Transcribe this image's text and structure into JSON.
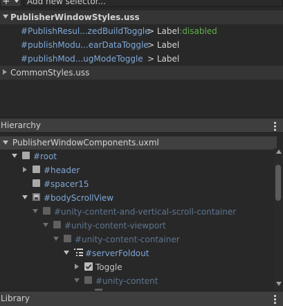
{
  "toolbar": {
    "add_icon": "plus-icon",
    "selector_placeholder": "Add new selector..."
  },
  "stylesheets": [
    {
      "name": "PublisherWindowStyles.uss",
      "expanded": true,
      "rules": [
        {
          "selector": "#PublishResul...zedBuildToggle",
          "target": "> Label",
          "pseudo": ":disabled"
        },
        {
          "selector": "#publishModu...earDataToggle",
          "target": "> Label",
          "pseudo": ""
        },
        {
          "selector": "#publishMod...ugModeToggle",
          "target": "> Label",
          "pseudo": ""
        }
      ]
    },
    {
      "name": "CommonStyles.uss",
      "expanded": false,
      "rules": []
    }
  ],
  "hierarchy": {
    "title": "Hierarchy",
    "file": "PublisherWindowComponents.uxml",
    "items": [
      {
        "name": "#root",
        "expander": "expanded",
        "icon": "element-box-icon",
        "style": "blue"
      },
      {
        "name": "#header",
        "expander": "collapsed",
        "icon": "element-box-icon",
        "style": "blue"
      },
      {
        "name": "#spacer15",
        "expander": "none",
        "icon": "element-box-icon",
        "style": "blue"
      },
      {
        "name": "#bodyScrollView",
        "expander": "expanded",
        "icon": "scrollview-icon",
        "style": "blue"
      },
      {
        "name": "#unity-content-and-vertical-scroll-container",
        "expander": "expanded",
        "icon": "element-box-icon",
        "style": "dim"
      },
      {
        "name": "#unity-content-viewport",
        "expander": "expanded",
        "icon": "element-box-icon",
        "style": "dim"
      },
      {
        "name": "#unity-content-container",
        "expander": "expanded",
        "icon": "element-box-icon",
        "style": "dim"
      },
      {
        "name": "#serverFoldout",
        "expander": "expanded",
        "icon": "foldout-list-icon",
        "style": "blue"
      },
      {
        "name": "Toggle",
        "expander": "collapsed",
        "icon": "toggle-checkbox-icon",
        "style": "light"
      },
      {
        "name": "#unity-content",
        "expander": "expanded",
        "icon": "element-box-icon",
        "style": "dim"
      }
    ]
  },
  "library": {
    "title": "Library"
  },
  "colors": {
    "background": "#282828",
    "selector_blue": "#7fa9d8",
    "pseudo_green": "#5fb04b",
    "header_bg": "#3e3e3e"
  }
}
